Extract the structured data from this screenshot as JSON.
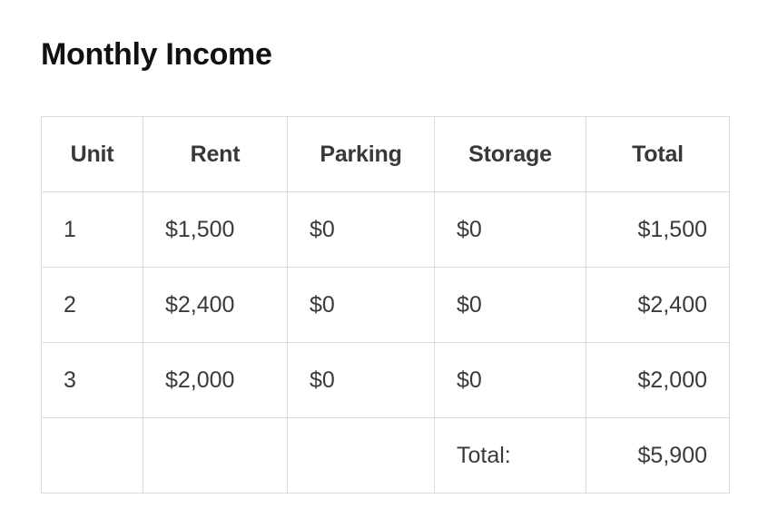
{
  "page": {
    "title": "Monthly Income",
    "background_color": "#ffffff",
    "title_color": "#111111",
    "text_color": "#3a3a3a",
    "header_text_color": "#383838",
    "border_color": "#dcdcdc"
  },
  "chart_data": {
    "type": "table",
    "title": "Monthly Income",
    "columns": [
      "Unit",
      "Rent",
      "Parking",
      "Storage",
      "Total"
    ],
    "column_alignments": [
      "left",
      "left",
      "left",
      "left",
      "right"
    ],
    "header_alignment": "center",
    "rows": [
      [
        "1",
        "$1,500",
        "$0",
        "$0",
        "$1,500"
      ],
      [
        "2",
        "$2,400",
        "$0",
        "$0",
        "$2,400"
      ],
      [
        "3",
        "$2,000",
        "$0",
        "$0",
        "$2,000"
      ],
      [
        "",
        "",
        "",
        "Total:",
        "$5,900"
      ]
    ],
    "numeric_values": {
      "rent": [
        1500,
        2400,
        2000
      ],
      "parking": [
        0,
        0,
        0
      ],
      "storage": [
        0,
        0,
        0
      ],
      "row_totals": [
        1500,
        2400,
        2000
      ],
      "grand_total": 5900
    },
    "grid": true,
    "legend": "none"
  },
  "table": {
    "headers": [
      {
        "label": "Unit"
      },
      {
        "label": "Rent"
      },
      {
        "label": "Parking"
      },
      {
        "label": "Storage"
      },
      {
        "label": "Total"
      }
    ],
    "rows": [
      {
        "unit": "1",
        "rent": "$1,500",
        "parking": "$0",
        "storage": "$0",
        "total": "$1,500"
      },
      {
        "unit": "2",
        "rent": "$2,400",
        "parking": "$0",
        "storage": "$0",
        "total": "$2,400"
      },
      {
        "unit": "3",
        "rent": "$2,000",
        "parking": "$0",
        "storage": "$0",
        "total": "$2,000"
      }
    ],
    "footer": {
      "unit": "",
      "rent": "",
      "parking": "",
      "label": "Total:",
      "total": "$5,900"
    }
  }
}
